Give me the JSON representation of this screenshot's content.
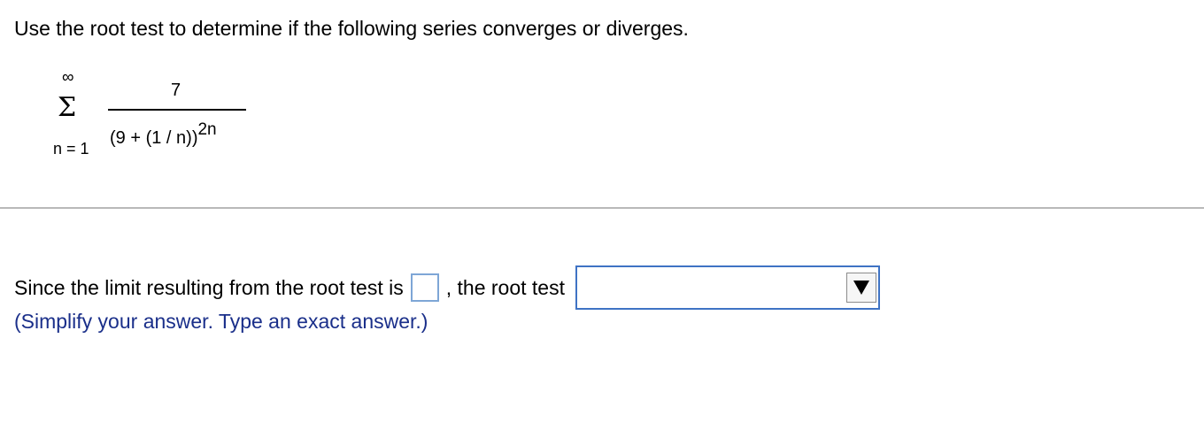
{
  "question": {
    "text": "Use the root test to determine if the following series converges or diverges."
  },
  "series": {
    "upper_limit": "∞",
    "sigma": "Σ",
    "lower_limit": "n = 1",
    "numerator": "7",
    "denominator_base": "(9 + (1 / n))",
    "denominator_exponent": "2n"
  },
  "answer": {
    "prefix": "Since the limit resulting from the root test is",
    "limit_value": "",
    "middle": ", the root test",
    "conclusion_selected": ""
  },
  "hint": {
    "text": "(Simplify your answer. Type an exact answer.)"
  },
  "colors": {
    "input_border": "#7ea6d6",
    "dropdown_border": "#3f73c4",
    "hint_text": "#1a2f8a",
    "divider": "#b9b9b9"
  },
  "icons": {
    "dropdown_arrow": "triangle-down-icon"
  }
}
